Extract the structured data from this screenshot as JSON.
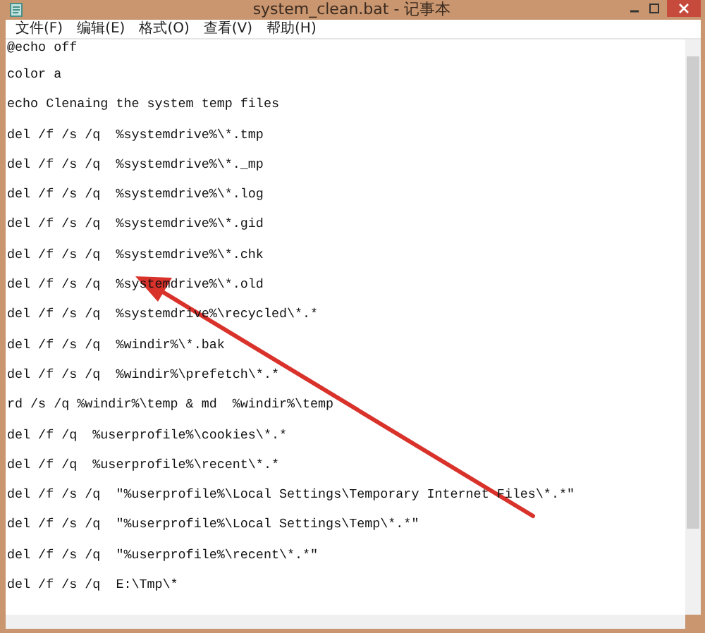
{
  "window": {
    "title": "system_clean.bat - 记事本"
  },
  "menu": [
    "文件(F)",
    "编辑(E)",
    "格式(O)",
    "查看(V)",
    "帮助(H)"
  ],
  "editor": {
    "lines": [
      "@echo off",
      "color a",
      "echo Clenaing the system temp files",
      "del /f /s /q  %systemdrive%\\*.tmp",
      "del /f /s /q  %systemdrive%\\*._mp",
      "del /f /s /q  %systemdrive%\\*.log",
      "del /f /s /q  %systemdrive%\\*.gid",
      "del /f /s /q  %systemdrive%\\*.chk",
      "del /f /s /q  %systemdrive%\\*.old",
      "del /f /s /q  %systemdrive%\\recycled\\*.*",
      "del /f /s /q  %windir%\\*.bak",
      "del /f /s /q  %windir%\\prefetch\\*.*",
      "rd /s /q %windir%\\temp & md  %windir%\\temp",
      "del /f /q  %userprofile%\\cookies\\*.*",
      "del /f /q  %userprofile%\\recent\\*.*",
      "del /f /s /q  \"%userprofile%\\Local Settings\\Temporary Internet Files\\*.*\"",
      "del /f /s /q  \"%userprofile%\\Local Settings\\Temp\\*.*\"",
      "del /f /s /q  \"%userprofile%\\recent\\*.*\"",
      "del /f /s /q  E:\\Tmp\\*"
    ]
  }
}
